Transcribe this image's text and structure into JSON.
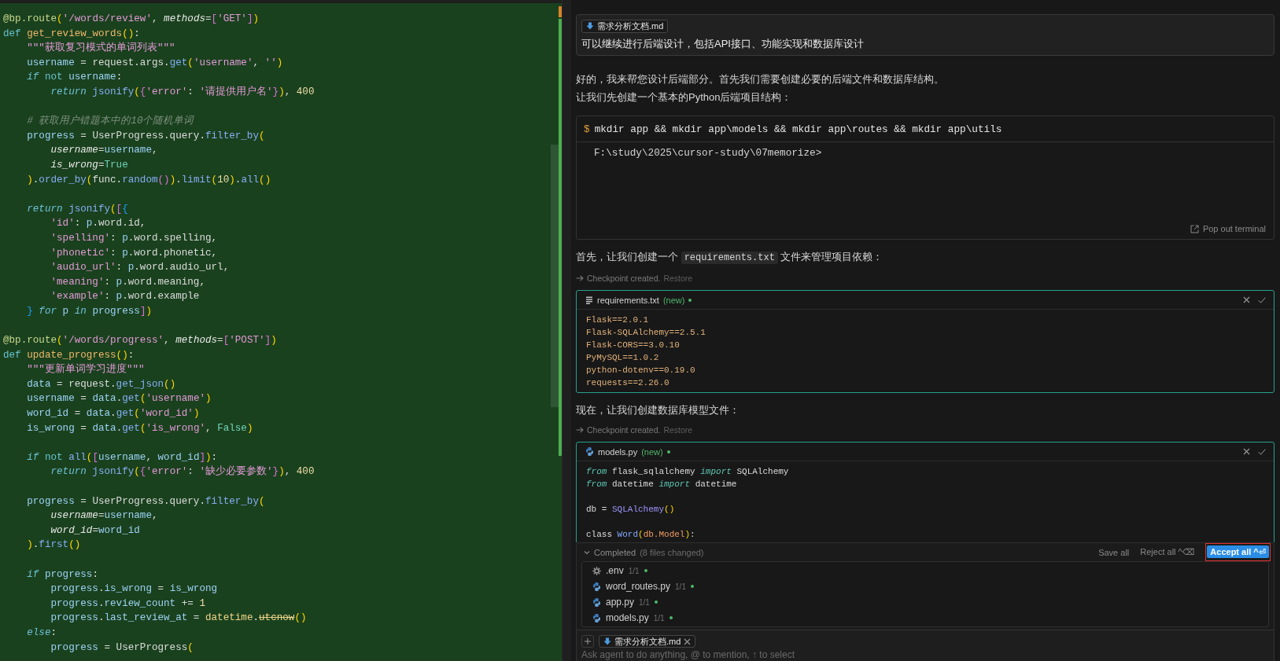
{
  "editor": {
    "lines": [
      {
        "kind": "code",
        "tokens": [
          {
            "kind": "deco",
            "text": "@bp.route"
          },
          {
            "kind": "b1",
            "text": "("
          },
          {
            "kind": "str",
            "text": "'/words/review'"
          },
          {
            "kind": "plain",
            "text": ", "
          },
          {
            "kind": "param",
            "text": "methods"
          },
          {
            "kind": "plain",
            "text": "="
          },
          {
            "kind": "b2",
            "text": "["
          },
          {
            "kind": "str",
            "text": "'GET'"
          },
          {
            "kind": "b2",
            "text": "]"
          },
          {
            "kind": "b1",
            "text": ")"
          }
        ]
      },
      {
        "kind": "code",
        "tokens": [
          {
            "kind": "kw",
            "text": "def"
          },
          {
            "kind": "fn",
            "text": " get_review_words"
          },
          {
            "kind": "b1",
            "text": "()"
          },
          {
            "kind": "plain",
            "text": ":"
          }
        ]
      },
      {
        "kind": "code",
        "tokens": [
          {
            "kind": "str",
            "text": "    \"\"\"获取复习模式的单词列表\"\"\""
          }
        ]
      },
      {
        "kind": "code",
        "tokens": [
          {
            "kind": "var",
            "text": "    username"
          },
          {
            "kind": "plain",
            "text": " = request.args."
          },
          {
            "kind": "call",
            "text": "get"
          },
          {
            "kind": "b1",
            "text": "("
          },
          {
            "kind": "str",
            "text": "'username'"
          },
          {
            "kind": "plain",
            "text": ", "
          },
          {
            "kind": "str",
            "text": "''"
          },
          {
            "kind": "b1",
            "text": ")"
          }
        ]
      },
      {
        "kind": "code",
        "tokens": [
          {
            "kind": "ctl",
            "text": "    if"
          },
          {
            "kind": "kw",
            "text": " not"
          },
          {
            "kind": "var",
            "text": " username"
          },
          {
            "kind": "plain",
            "text": ":"
          }
        ]
      },
      {
        "kind": "code",
        "tokens": [
          {
            "kind": "ctl",
            "text": "        return"
          },
          {
            "kind": "call",
            "text": " jsonify"
          },
          {
            "kind": "b1",
            "text": "("
          },
          {
            "kind": "b2",
            "text": "{"
          },
          {
            "kind": "str",
            "text": "'error'"
          },
          {
            "kind": "plain",
            "text": ": "
          },
          {
            "kind": "str",
            "text": "'请提供用户名'"
          },
          {
            "kind": "b2",
            "text": "}"
          },
          {
            "kind": "b1",
            "text": ")"
          },
          {
            "kind": "plain",
            "text": ", "
          },
          {
            "kind": "num",
            "text": "400"
          }
        ]
      },
      {
        "kind": "blank"
      },
      {
        "kind": "code",
        "tokens": [
          {
            "kind": "cmt",
            "text": "    # 获取用户错题本中的10个随机单词"
          }
        ]
      },
      {
        "kind": "code",
        "tokens": [
          {
            "kind": "var",
            "text": "    progress"
          },
          {
            "kind": "plain",
            "text": " = UserProgress.query."
          },
          {
            "kind": "call",
            "text": "filter_by"
          },
          {
            "kind": "b1",
            "text": "("
          }
        ]
      },
      {
        "kind": "code",
        "tokens": [
          {
            "kind": "param",
            "text": "        username"
          },
          {
            "kind": "plain",
            "text": "="
          },
          {
            "kind": "var",
            "text": "username"
          },
          {
            "kind": "plain",
            "text": ","
          }
        ]
      },
      {
        "kind": "code",
        "tokens": [
          {
            "kind": "param",
            "text": "        is_wrong"
          },
          {
            "kind": "plain",
            "text": "="
          },
          {
            "kind": "const",
            "text": "True"
          }
        ]
      },
      {
        "kind": "code",
        "tokens": [
          {
            "kind": "b1",
            "text": "    )"
          },
          {
            "kind": "plain",
            "text": "."
          },
          {
            "kind": "call",
            "text": "order_by"
          },
          {
            "kind": "b1",
            "text": "("
          },
          {
            "kind": "plain",
            "text": "func."
          },
          {
            "kind": "call",
            "text": "random"
          },
          {
            "kind": "b2",
            "text": "()"
          },
          {
            "kind": "b1",
            "text": ")"
          },
          {
            "kind": "plain",
            "text": "."
          },
          {
            "kind": "call",
            "text": "limit"
          },
          {
            "kind": "b1",
            "text": "("
          },
          {
            "kind": "num",
            "text": "10"
          },
          {
            "kind": "b1",
            "text": ")"
          },
          {
            "kind": "plain",
            "text": "."
          },
          {
            "kind": "call",
            "text": "all"
          },
          {
            "kind": "b1",
            "text": "()"
          }
        ]
      },
      {
        "kind": "blank"
      },
      {
        "kind": "code",
        "tokens": [
          {
            "kind": "ctl",
            "text": "    return"
          },
          {
            "kind": "call",
            "text": " jsonify"
          },
          {
            "kind": "b1",
            "text": "("
          },
          {
            "kind": "b2",
            "text": "["
          },
          {
            "kind": "b3",
            "text": "{"
          }
        ]
      },
      {
        "kind": "code",
        "tokens": [
          {
            "kind": "str",
            "text": "        'id'"
          },
          {
            "kind": "plain",
            "text": ": "
          },
          {
            "kind": "var",
            "text": "p"
          },
          {
            "kind": "plain",
            "text": ".word.id,"
          }
        ]
      },
      {
        "kind": "code",
        "tokens": [
          {
            "kind": "str",
            "text": "        'spelling'"
          },
          {
            "kind": "plain",
            "text": ": "
          },
          {
            "kind": "var",
            "text": "p"
          },
          {
            "kind": "plain",
            "text": ".word.spelling,"
          }
        ]
      },
      {
        "kind": "code",
        "tokens": [
          {
            "kind": "str",
            "text": "        'phonetic'"
          },
          {
            "kind": "plain",
            "text": ": "
          },
          {
            "kind": "var",
            "text": "p"
          },
          {
            "kind": "plain",
            "text": ".word.phonetic,"
          }
        ]
      },
      {
        "kind": "code",
        "tokens": [
          {
            "kind": "str",
            "text": "        'audio_url'"
          },
          {
            "kind": "plain",
            "text": ": "
          },
          {
            "kind": "var",
            "text": "p"
          },
          {
            "kind": "plain",
            "text": ".word.audio_url,"
          }
        ]
      },
      {
        "kind": "code",
        "tokens": [
          {
            "kind": "str",
            "text": "        'meaning'"
          },
          {
            "kind": "plain",
            "text": ": "
          },
          {
            "kind": "var",
            "text": "p"
          },
          {
            "kind": "plain",
            "text": ".word.meaning,"
          }
        ]
      },
      {
        "kind": "code",
        "tokens": [
          {
            "kind": "str",
            "text": "        'example'"
          },
          {
            "kind": "plain",
            "text": ": "
          },
          {
            "kind": "var",
            "text": "p"
          },
          {
            "kind": "plain",
            "text": ".word.example"
          }
        ]
      },
      {
        "kind": "code",
        "tokens": [
          {
            "kind": "b3",
            "text": "    }"
          },
          {
            "kind": "ctl",
            "text": " for"
          },
          {
            "kind": "var",
            "text": " p"
          },
          {
            "kind": "ctl",
            "text": " in"
          },
          {
            "kind": "var",
            "text": " progress"
          },
          {
            "kind": "b2",
            "text": "]"
          },
          {
            "kind": "b1",
            "text": ")"
          }
        ]
      },
      {
        "kind": "blank"
      },
      {
        "kind": "code",
        "tokens": [
          {
            "kind": "deco",
            "text": "@bp.route"
          },
          {
            "kind": "b1",
            "text": "("
          },
          {
            "kind": "str",
            "text": "'/words/progress'"
          },
          {
            "kind": "plain",
            "text": ", "
          },
          {
            "kind": "param",
            "text": "methods"
          },
          {
            "kind": "plain",
            "text": "="
          },
          {
            "kind": "b2",
            "text": "["
          },
          {
            "kind": "str",
            "text": "'POST'"
          },
          {
            "kind": "b2",
            "text": "]"
          },
          {
            "kind": "b1",
            "text": ")"
          }
        ]
      },
      {
        "kind": "code",
        "tokens": [
          {
            "kind": "kw",
            "text": "def"
          },
          {
            "kind": "fn",
            "text": " update_progress"
          },
          {
            "kind": "b1",
            "text": "()"
          },
          {
            "kind": "plain",
            "text": ":"
          }
        ]
      },
      {
        "kind": "code",
        "tokens": [
          {
            "kind": "str",
            "text": "    \"\"\"更新单词学习进度\"\"\""
          }
        ]
      },
      {
        "kind": "code",
        "tokens": [
          {
            "kind": "var",
            "text": "    data"
          },
          {
            "kind": "plain",
            "text": " = request."
          },
          {
            "kind": "call",
            "text": "get_json"
          },
          {
            "kind": "b1",
            "text": "()"
          }
        ]
      },
      {
        "kind": "code",
        "tokens": [
          {
            "kind": "var",
            "text": "    username"
          },
          {
            "kind": "plain",
            "text": " = "
          },
          {
            "kind": "var",
            "text": "data"
          },
          {
            "kind": "plain",
            "text": "."
          },
          {
            "kind": "call",
            "text": "get"
          },
          {
            "kind": "b1",
            "text": "("
          },
          {
            "kind": "str",
            "text": "'username'"
          },
          {
            "kind": "b1",
            "text": ")"
          }
        ]
      },
      {
        "kind": "code",
        "tokens": [
          {
            "kind": "var",
            "text": "    word_id"
          },
          {
            "kind": "plain",
            "text": " = "
          },
          {
            "kind": "var",
            "text": "data"
          },
          {
            "kind": "plain",
            "text": "."
          },
          {
            "kind": "call",
            "text": "get"
          },
          {
            "kind": "b1",
            "text": "("
          },
          {
            "kind": "str",
            "text": "'word_id'"
          },
          {
            "kind": "b1",
            "text": ")"
          }
        ]
      },
      {
        "kind": "code",
        "tokens": [
          {
            "kind": "var",
            "text": "    is_wrong"
          },
          {
            "kind": "plain",
            "text": " = "
          },
          {
            "kind": "var",
            "text": "data"
          },
          {
            "kind": "plain",
            "text": "."
          },
          {
            "kind": "call",
            "text": "get"
          },
          {
            "kind": "b1",
            "text": "("
          },
          {
            "kind": "str",
            "text": "'is_wrong'"
          },
          {
            "kind": "plain",
            "text": ", "
          },
          {
            "kind": "const",
            "text": "False"
          },
          {
            "kind": "b1",
            "text": ")"
          }
        ]
      },
      {
        "kind": "blank"
      },
      {
        "kind": "code",
        "tokens": [
          {
            "kind": "ctl",
            "text": "    if"
          },
          {
            "kind": "kw",
            "text": " not"
          },
          {
            "kind": "call",
            "text": " all"
          },
          {
            "kind": "b1",
            "text": "("
          },
          {
            "kind": "b2",
            "text": "["
          },
          {
            "kind": "var",
            "text": "username"
          },
          {
            "kind": "plain",
            "text": ", "
          },
          {
            "kind": "var",
            "text": "word_id"
          },
          {
            "kind": "b2",
            "text": "]"
          },
          {
            "kind": "b1",
            "text": ")"
          },
          {
            "kind": "plain",
            "text": ":"
          }
        ]
      },
      {
        "kind": "code",
        "tokens": [
          {
            "kind": "ctl",
            "text": "        return"
          },
          {
            "kind": "call",
            "text": " jsonify"
          },
          {
            "kind": "b1",
            "text": "("
          },
          {
            "kind": "b2",
            "text": "{"
          },
          {
            "kind": "str",
            "text": "'error'"
          },
          {
            "kind": "plain",
            "text": ": "
          },
          {
            "kind": "str",
            "text": "'缺少必要参数'"
          },
          {
            "kind": "b2",
            "text": "}"
          },
          {
            "kind": "b1",
            "text": ")"
          },
          {
            "kind": "plain",
            "text": ", "
          },
          {
            "kind": "num",
            "text": "400"
          }
        ]
      },
      {
        "kind": "blank"
      },
      {
        "kind": "code",
        "tokens": [
          {
            "kind": "var",
            "text": "    progress"
          },
          {
            "kind": "plain",
            "text": " = UserProgress.query."
          },
          {
            "kind": "call",
            "text": "filter_by"
          },
          {
            "kind": "b1",
            "text": "("
          }
        ]
      },
      {
        "kind": "code",
        "tokens": [
          {
            "kind": "param",
            "text": "        username"
          },
          {
            "kind": "plain",
            "text": "="
          },
          {
            "kind": "var",
            "text": "username"
          },
          {
            "kind": "plain",
            "text": ","
          }
        ]
      },
      {
        "kind": "code",
        "tokens": [
          {
            "kind": "param",
            "text": "        word_id"
          },
          {
            "kind": "plain",
            "text": "="
          },
          {
            "kind": "var",
            "text": "word_id"
          }
        ]
      },
      {
        "kind": "code",
        "tokens": [
          {
            "kind": "b1",
            "text": "    )"
          },
          {
            "kind": "plain",
            "text": "."
          },
          {
            "kind": "call",
            "text": "first"
          },
          {
            "kind": "b1",
            "text": "()"
          }
        ]
      },
      {
        "kind": "blank"
      },
      {
        "kind": "code",
        "tokens": [
          {
            "kind": "ctl",
            "text": "    if"
          },
          {
            "kind": "var",
            "text": " progress"
          },
          {
            "kind": "plain",
            "text": ":"
          }
        ]
      },
      {
        "kind": "code",
        "tokens": [
          {
            "kind": "var",
            "text": "        progress"
          },
          {
            "kind": "plain",
            "text": "."
          },
          {
            "kind": "var",
            "text": "is_wrong"
          },
          {
            "kind": "plain",
            "text": " = "
          },
          {
            "kind": "var",
            "text": "is_wrong"
          }
        ]
      },
      {
        "kind": "code",
        "tokens": [
          {
            "kind": "var",
            "text": "        progress"
          },
          {
            "kind": "plain",
            "text": "."
          },
          {
            "kind": "var",
            "text": "review_count"
          },
          {
            "kind": "plain",
            "text": " += "
          },
          {
            "kind": "num",
            "text": "1"
          }
        ]
      },
      {
        "kind": "code",
        "tokens": [
          {
            "kind": "var",
            "text": "        progress"
          },
          {
            "kind": "plain",
            "text": "."
          },
          {
            "kind": "var",
            "text": "last_review_at"
          },
          {
            "kind": "plain",
            "text": " = "
          },
          {
            "kind": "cls",
            "text": "datetime"
          },
          {
            "kind": "plain",
            "text": "."
          },
          {
            "kind": "dep",
            "text": "utcnow"
          },
          {
            "kind": "b1",
            "text": "()"
          }
        ]
      },
      {
        "kind": "code",
        "tokens": [
          {
            "kind": "ctl",
            "text": "    else"
          },
          {
            "kind": "plain",
            "text": ":"
          }
        ]
      },
      {
        "kind": "code",
        "tokens": [
          {
            "kind": "var",
            "text": "        progress"
          },
          {
            "kind": "plain",
            "text": " = UserProgress"
          },
          {
            "kind": "b1",
            "text": "("
          }
        ]
      }
    ]
  },
  "chat": {
    "user_message": {
      "attachment": {
        "name": "需求分析文档.md"
      },
      "text": "可以继续进行后端设计，包括API接口、功能实现和数据库设计"
    },
    "items": [
      {
        "kind": "paragraph",
        "parts": [
          {
            "kind": "text",
            "text": "好的，我来帮您设计后端部分。首先我们需要创建必要的后端文件和数据库结构。"
          }
        ]
      },
      {
        "kind": "paragraph",
        "parts": [
          {
            "kind": "text",
            "text": "让我们先创建一个基本的Python后端项目结构："
          }
        ]
      },
      {
        "kind": "terminal",
        "prompt": "$",
        "command": "mkdir app && mkdir app\\models && mkdir app\\routes && mkdir app\\utils",
        "output": "F:\\study\\2025\\cursor-study\\07memorize>",
        "action": "Pop out terminal"
      },
      {
        "kind": "paragraph",
        "parts": [
          {
            "kind": "text",
            "text": "首先，让我们创建一个 "
          },
          {
            "kind": "code",
            "text": "requirements.txt"
          },
          {
            "kind": "text",
            "text": " 文件来管理项目依赖："
          }
        ]
      },
      {
        "kind": "checkpoint",
        "text": "Checkpoint created.",
        "link": "Restore"
      },
      {
        "kind": "text_file",
        "filename": "requirements.txt",
        "status": "(new)",
        "modified": true,
        "lines": [
          {
            "kind": "code",
            "tokens": [
              {
                "kind": "text",
                "text": "Flask==2.0.1"
              }
            ]
          },
          {
            "kind": "code",
            "tokens": [
              {
                "kind": "text",
                "text": "Flask-SQLAlchemy==2.5.1"
              }
            ]
          },
          {
            "kind": "code",
            "tokens": [
              {
                "kind": "text",
                "text": "Flask-CORS==3.0.10"
              }
            ]
          },
          {
            "kind": "code",
            "tokens": [
              {
                "kind": "text",
                "text": "PyMySQL==1.0.2"
              }
            ]
          },
          {
            "kind": "code",
            "tokens": [
              {
                "kind": "text",
                "text": "python-dotenv==0.19.0"
              }
            ]
          },
          {
            "kind": "code",
            "tokens": [
              {
                "kind": "text",
                "text": "requests==2.26.0"
              }
            ]
          }
        ]
      },
      {
        "kind": "paragraph",
        "parts": [
          {
            "kind": "text",
            "text": "现在，让我们创建数据库模型文件："
          }
        ]
      },
      {
        "kind": "checkpoint",
        "text": "Checkpoint created.",
        "link": "Restore"
      },
      {
        "kind": "python_file",
        "filename": "models.py",
        "status": "(new)",
        "modified": true,
        "lines": [
          {
            "kind": "code",
            "tokens": [
              {
                "kind": "ctl",
                "text": "from"
              },
              {
                "kind": "plain",
                "text": " flask_sqlalchemy "
              },
              {
                "kind": "ctl",
                "text": "import"
              },
              {
                "kind": "plain",
                "text": " SQLAlchemy"
              }
            ]
          },
          {
            "kind": "code",
            "tokens": [
              {
                "kind": "ctl",
                "text": "from"
              },
              {
                "kind": "plain",
                "text": " datetime "
              },
              {
                "kind": "ctl",
                "text": "import"
              },
              {
                "kind": "plain",
                "text": " datetime"
              }
            ]
          },
          {
            "kind": "blank"
          },
          {
            "kind": "code",
            "tokens": [
              {
                "kind": "plain",
                "text": "db = "
              },
              {
                "kind": "ctor",
                "text": "SQLAlchemy"
              },
              {
                "kind": "b1",
                "text": "()"
              }
            ]
          },
          {
            "kind": "blank"
          },
          {
            "kind": "code",
            "tokens": [
              {
                "kind": "plain",
                "text": "class "
              },
              {
                "kind": "type",
                "text": "Word"
              },
              {
                "kind": "b1",
                "text": "("
              },
              {
                "kind": "attr",
                "text": "db.Model"
              },
              {
                "kind": "b1",
                "text": ")"
              },
              {
                "kind": "plain",
                "text": ":"
              }
            ]
          }
        ]
      }
    ]
  },
  "changes": {
    "expanded": true,
    "title": "Completed",
    "summary": "(8 files changed)",
    "actions": [
      {
        "kind": "secondary",
        "label": "Save all",
        "highlighted": false
      },
      {
        "kind": "secondary",
        "label": "Reject all",
        "shortcut": "^⌫",
        "highlighted": false
      },
      {
        "kind": "primary",
        "label": "Accept all",
        "shortcut": "^⏎",
        "highlighted": true
      }
    ],
    "files": [
      {
        "kind": "config",
        "name": ".env",
        "count": "1/1",
        "modified": true
      },
      {
        "kind": "python",
        "name": "word_routes.py",
        "count": "1/1",
        "modified": true
      },
      {
        "kind": "python",
        "name": "app.py",
        "count": "1/1",
        "modified": true
      },
      {
        "kind": "python",
        "name": "models.py",
        "count": "1/1",
        "modified": true
      }
    ]
  },
  "composer": {
    "attachment": {
      "name": "需求分析文档.md"
    },
    "placeholder": "Ask agent to do anything, @ to mention, ↑ to select"
  }
}
